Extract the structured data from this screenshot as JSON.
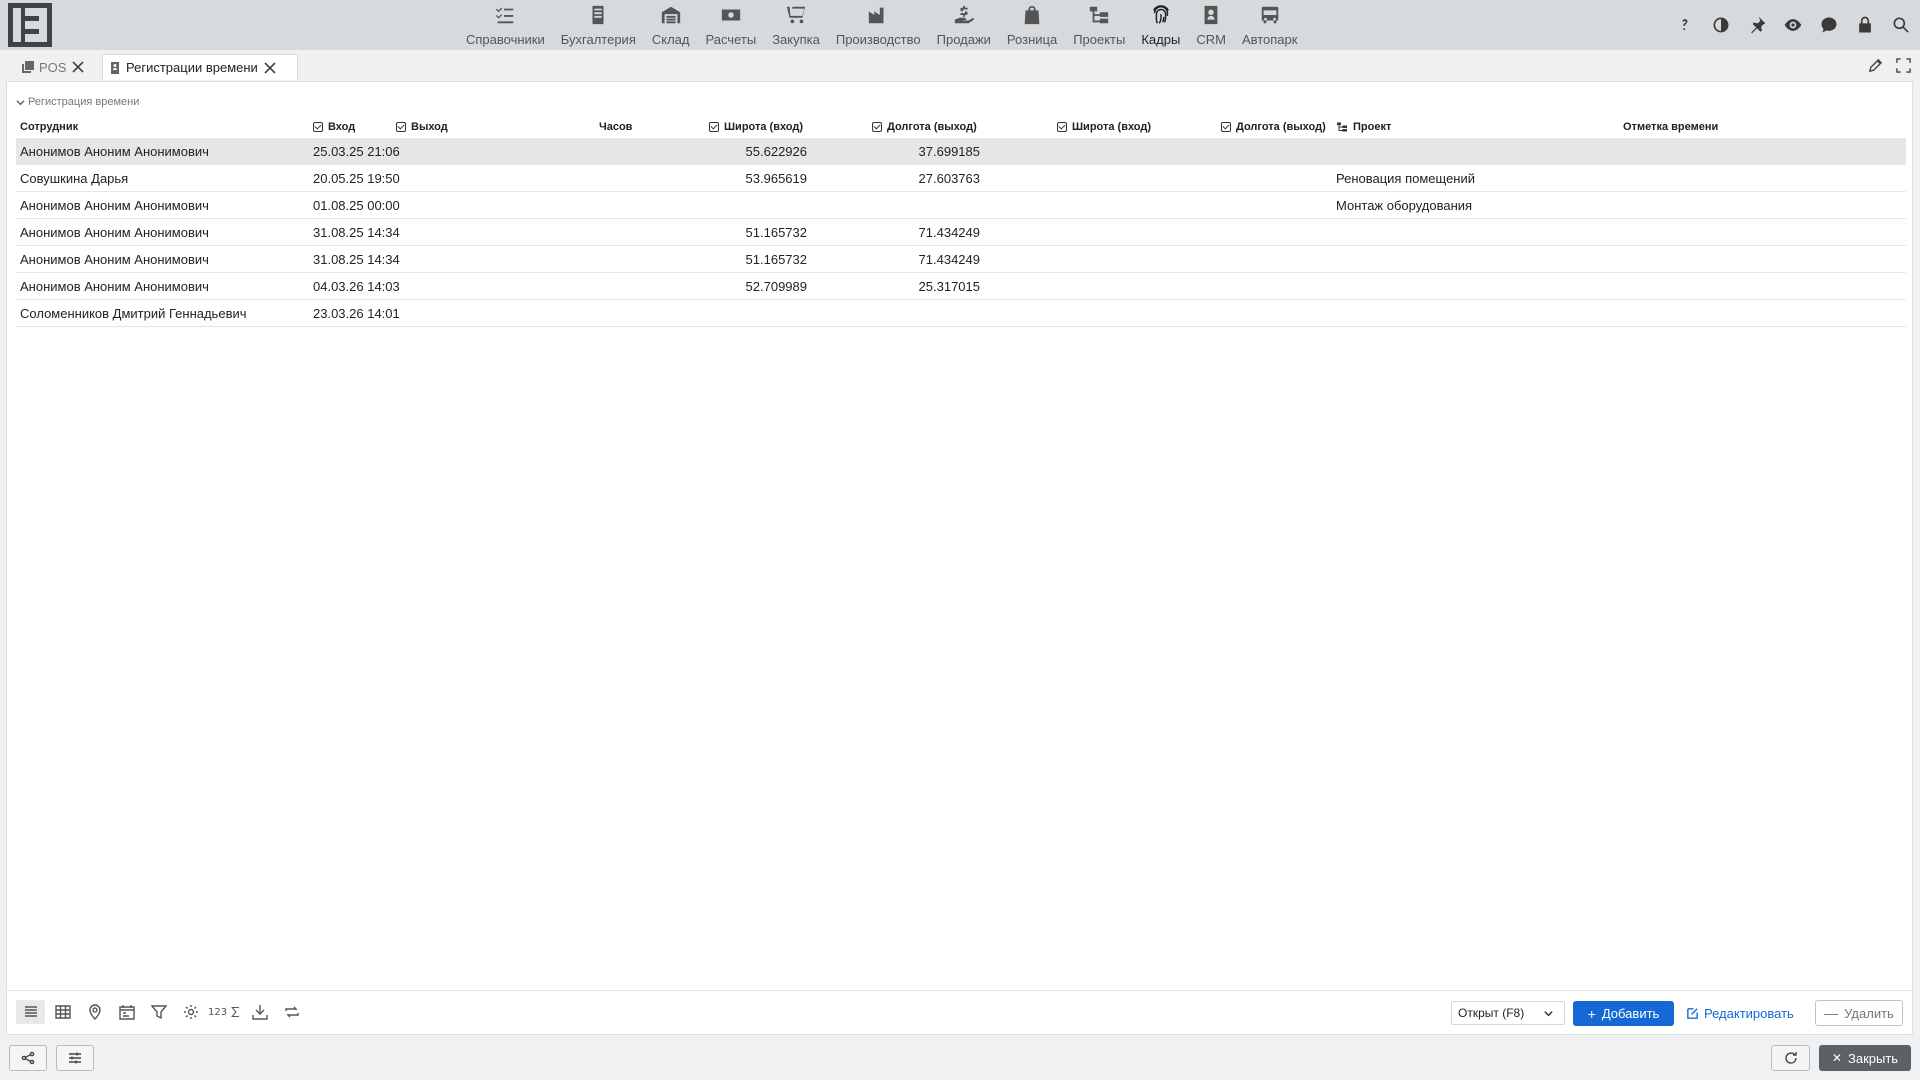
{
  "nav": {
    "items": [
      {
        "label": "Справочники",
        "icon": "checklist-icon"
      },
      {
        "label": "Бухгалтерия",
        "icon": "ledger-icon"
      },
      {
        "label": "Склад",
        "icon": "warehouse-icon"
      },
      {
        "label": "Расчеты",
        "icon": "money-icon"
      },
      {
        "label": "Закупка",
        "icon": "cart-icon"
      },
      {
        "label": "Производство",
        "icon": "factory-icon"
      },
      {
        "label": "Продажи",
        "icon": "hand-money-icon"
      },
      {
        "label": "Розница",
        "icon": "shopping-bag-icon"
      },
      {
        "label": "Проекты",
        "icon": "project-tree-icon"
      },
      {
        "label": "Кадры",
        "icon": "fingerprint-icon"
      },
      {
        "label": "CRM",
        "icon": "contact-card-icon"
      },
      {
        "label": "Автопарк",
        "icon": "bus-icon"
      }
    ],
    "active": "Кадры"
  },
  "top_actions": [
    "help-icon",
    "contrast-icon",
    "pin-icon",
    "eye-icon",
    "chat-icon",
    "lock-icon",
    "search-icon"
  ],
  "tabs": [
    {
      "label": "POS",
      "active": false
    },
    {
      "label": "Регистрации времени",
      "active": true
    }
  ],
  "section": {
    "title": "Регистрация времени"
  },
  "table": {
    "headers": {
      "employee": "Сотрудник",
      "in": "Вход",
      "out": "Выход",
      "hours": "Часов",
      "lat_in": "Широта (вход)",
      "lon_out": "Долгота (выход)",
      "lat_in2": "Широта (вход)",
      "lon_out2": "Долгота (выход)",
      "project": "Проект",
      "timestamp": "Отметка времени"
    },
    "rows": [
      {
        "employee": "Анонимов Аноним Анонимович",
        "in": "25.03.25 21:06",
        "out": "",
        "hours": "",
        "lat_in": "55.622926",
        "lon_out": "37.699185",
        "lat_in2": "",
        "lon_out2": "",
        "project": "",
        "timestamp": "",
        "selected": true
      },
      {
        "employee": "Совушкина Дарья",
        "in": "20.05.25 19:50",
        "out": "",
        "hours": "",
        "lat_in": "53.965619",
        "lon_out": "27.603763",
        "lat_in2": "",
        "lon_out2": "",
        "project": "Реновация помещений",
        "timestamp": ""
      },
      {
        "employee": "Анонимов Аноним Анонимович",
        "in": "01.08.25 00:00",
        "out": "",
        "hours": "",
        "lat_in": "",
        "lon_out": "",
        "lat_in2": "",
        "lon_out2": "",
        "project": "Монтаж оборудования",
        "timestamp": ""
      },
      {
        "employee": "Анонимов Аноним Анонимович",
        "in": "31.08.25 14:34",
        "out": "",
        "hours": "",
        "lat_in": "51.165732",
        "lon_out": "71.434249",
        "lat_in2": "",
        "lon_out2": "",
        "project": "",
        "timestamp": ""
      },
      {
        "employee": "Анонимов Аноним Анонимович",
        "in": "31.08.25 14:34",
        "out": "",
        "hours": "",
        "lat_in": "51.165732",
        "lon_out": "71.434249",
        "lat_in2": "",
        "lon_out2": "",
        "project": "",
        "timestamp": ""
      },
      {
        "employee": "Анонимов Аноним Анонимович",
        "in": "04.03.26 14:03",
        "out": "",
        "hours": "",
        "lat_in": "52.709989",
        "lon_out": "25.317015",
        "lat_in2": "",
        "lon_out2": "",
        "project": "",
        "timestamp": ""
      },
      {
        "employee": "Соломенников Дмитрий Геннадьевич",
        "in": "23.03.26 14:01",
        "out": "",
        "hours": "",
        "lat_in": "",
        "lon_out": "",
        "lat_in2": "",
        "lon_out2": "",
        "project": "",
        "timestamp": ""
      }
    ]
  },
  "toolbar": {
    "sum_label": "123",
    "status_value": "Открыт (F8)",
    "add_label": "Добавить",
    "edit_label": "Редактировать",
    "delete_label": "Удалить"
  },
  "footer": {
    "close_label": "Закрыть"
  },
  "colors": {
    "accent": "#1469d6",
    "topbar": "#d7dadd",
    "selected_row": "#e6e6e6",
    "close_button": "#5d6166"
  }
}
